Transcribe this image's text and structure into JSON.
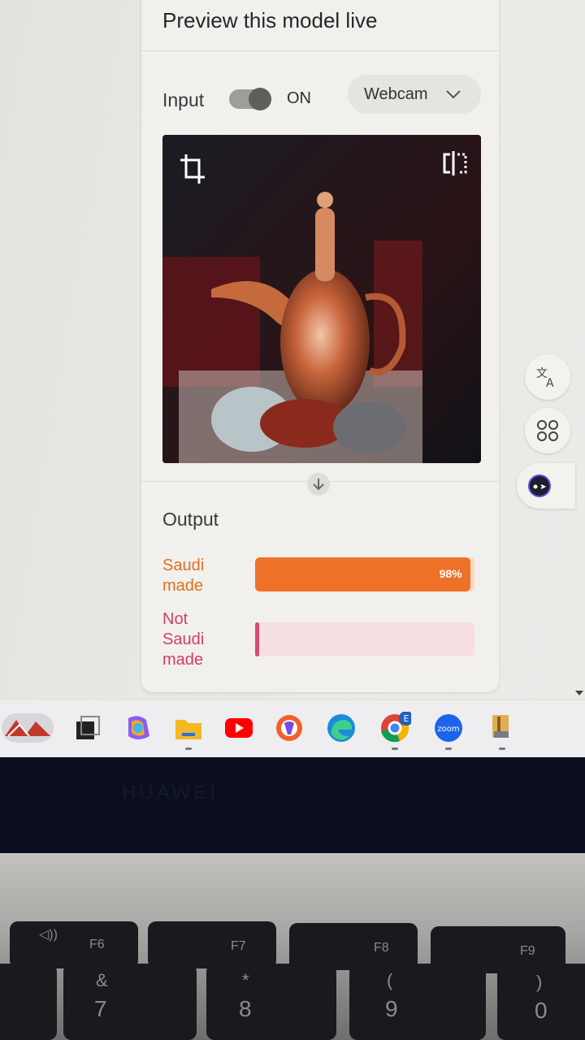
{
  "panel": {
    "title": "Preview this model live",
    "input_label": "Input",
    "toggle_state": "ON",
    "source_select": "Webcam",
    "output_label": "Output"
  },
  "classes": [
    {
      "label": "Saudi made",
      "confidence": 0.98,
      "percent_label": "98%",
      "color": "#ee7128"
    },
    {
      "label": "Not Saudi made",
      "confidence": 0.01,
      "percent_label": "",
      "color": "#d94a70"
    }
  ],
  "side_tools": [
    "translate-icon",
    "apps-grid-icon",
    "assistant-icon"
  ],
  "taskbar": [
    "weather-widget",
    "task-view-icon",
    "copilot-icon",
    "file-explorer-icon",
    "youtube-icon",
    "brave-icon",
    "edge-icon",
    "chrome-icon",
    "zoom-icon",
    "winrar-icon"
  ],
  "taskbar_labels": {
    "chrome_badge": "E",
    "zoom_text": "zoom"
  },
  "laptop": {
    "brand": "HUAWEI",
    "keys": [
      "F6",
      "F7",
      "F8",
      "F9"
    ],
    "number_row": [
      "&",
      "7",
      "*",
      "8",
      "(",
      "9",
      ")",
      "0"
    ]
  }
}
